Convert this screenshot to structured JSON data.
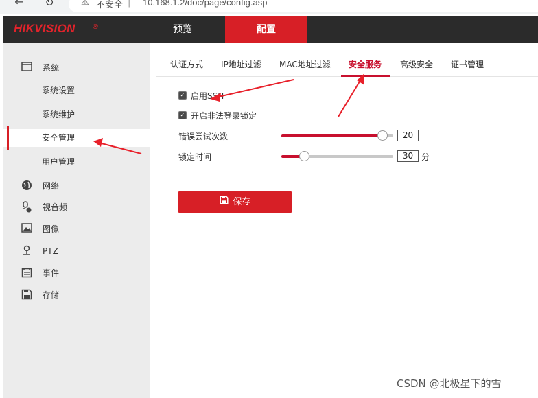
{
  "browser": {
    "back_icon": "back-arrow-icon",
    "reload_icon": "reload-icon",
    "warning_icon": "warning-icon",
    "insecure_label": "不安全",
    "separator": "|",
    "url": "10.168.1.2/doc/page/config.asp"
  },
  "header": {
    "logo": "HIKVISION",
    "logo_mark": "®",
    "tabs": {
      "preview": "预览",
      "config": "配置"
    }
  },
  "sidebar": {
    "system": "系统",
    "system_settings": "系统设置",
    "system_maintenance": "系统维护",
    "security_management": "安全管理",
    "user_management": "用户管理",
    "network": "网络",
    "audio_video": "视音频",
    "image": "图像",
    "ptz": "PTZ",
    "event": "事件",
    "storage": "存储"
  },
  "subtabs": {
    "auth": "认证方式",
    "ip_filter": "IP地址过滤",
    "mac_filter": "MAC地址过滤",
    "security_service": "安全服务",
    "advanced_security": "高级安全",
    "cert_management": "证书管理"
  },
  "form": {
    "enable_ssh": {
      "label": "启用SSH",
      "checked": true
    },
    "enable_lock": {
      "label": "开启非法登录锁定",
      "checked": true
    },
    "error_attempts": {
      "label": "错误尝试次数",
      "value": "20",
      "level": 0.9
    },
    "lock_time": {
      "label": "锁定时间",
      "value": "30",
      "unit": "分",
      "level": 0.2
    },
    "save": "保存"
  },
  "colors": {
    "accent": "#d71f26",
    "header_bg": "#2b2b2b",
    "sidebar_bg": "#ececec"
  },
  "watermark": "CSDN @北极星下的雪"
}
